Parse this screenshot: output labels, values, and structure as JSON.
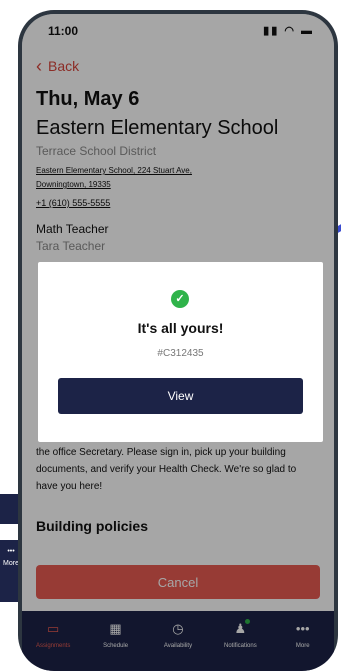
{
  "status": {
    "time": "11:00",
    "icons": "▮▮ ◠ ▬"
  },
  "header": {
    "back_label": "Back"
  },
  "assignment": {
    "date": "Thu, May 6",
    "school": "Eastern Elementary School",
    "district": "Terrace School District",
    "address_line1": "Eastern Elementary School, 224 Stuart Ave,",
    "address_line2": "Downingtown, 19335",
    "phone": "+1 (610) 555-5555",
    "role": "Math Teacher",
    "teacher": "Tara Teacher",
    "instructions": "the office Secretary. Please sign in, pick up your building documents, and verify your Health Check. We're so glad to have you here!",
    "policies_heading": "Building policies"
  },
  "actions": {
    "cancel_label": "Cancel"
  },
  "modal": {
    "title": "It's all yours!",
    "code": "#C312435",
    "view_label": "View"
  },
  "tabs": [
    {
      "label": "Assignments",
      "icon": "📋"
    },
    {
      "label": "Schedule",
      "icon": "📅"
    },
    {
      "label": "Availability",
      "icon": "◷"
    },
    {
      "label": "Notifications",
      "icon": "🔔"
    },
    {
      "label": "More",
      "icon": "•••"
    }
  ],
  "behind_card": {
    "icon": "•••",
    "label": "More"
  },
  "colors": {
    "accent": "#e85b52",
    "navy": "#1c2347",
    "success": "#2fb34a"
  }
}
